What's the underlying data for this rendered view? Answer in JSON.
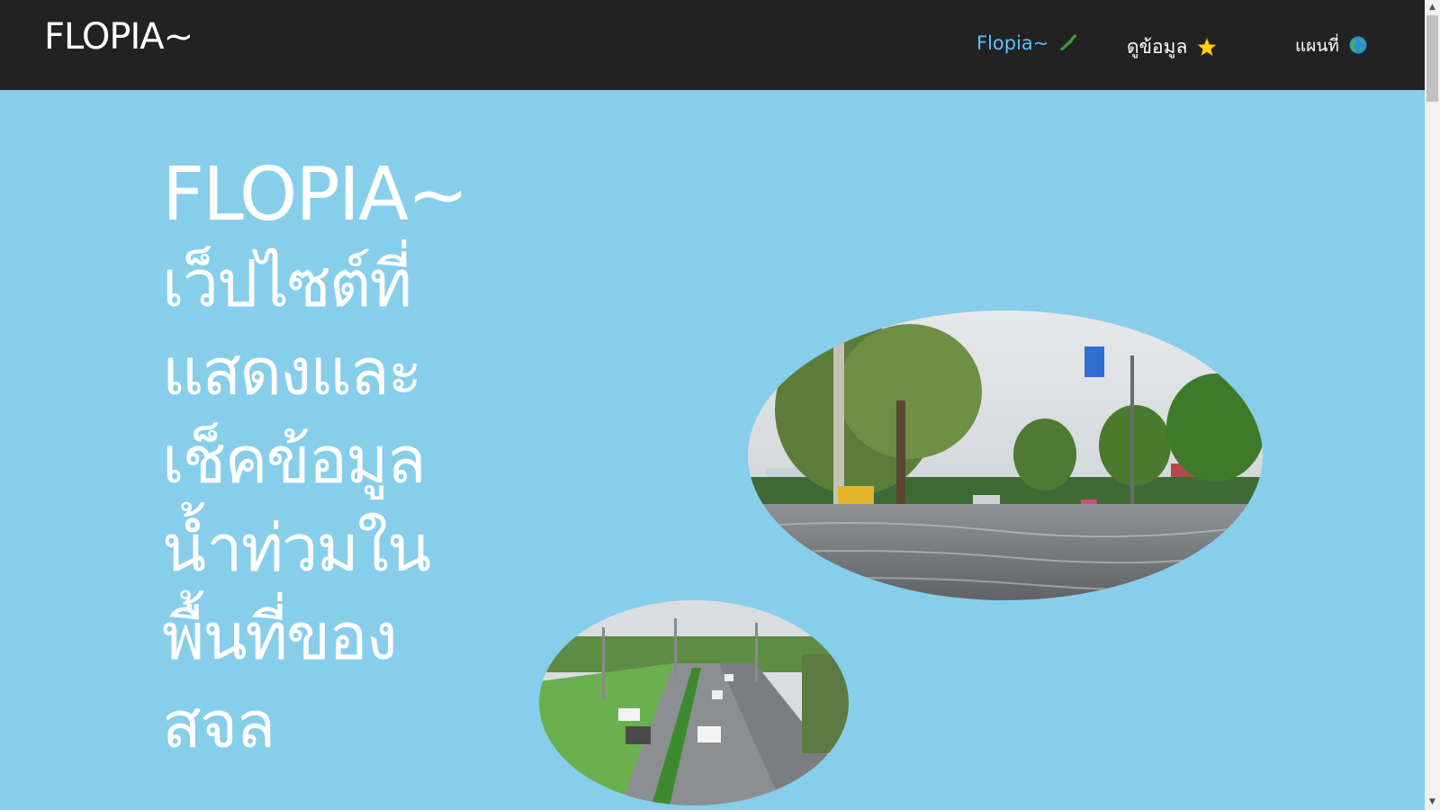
{
  "navbar": {
    "brand": "FLOPIA~",
    "items": [
      {
        "label": "Flopia~",
        "icon": "japan-map-icon",
        "active": true
      },
      {
        "label": "ดูข้อมูล",
        "icon": "star-icon",
        "active": false
      },
      {
        "label": "แผนที่",
        "icon": "globe-icon",
        "active": false
      }
    ]
  },
  "hero": {
    "title": "FLOPIA~",
    "subtitle": "เว็ปไซต์ที่แสดงและเช็คข้อมูลน้ำท่วมในพื้นที่ของ สจล"
  },
  "images": [
    {
      "name": "flooded-street-photo",
      "description_icon": "photo"
    },
    {
      "name": "flooded-road-aerial-photo",
      "description_icon": "photo"
    }
  ],
  "colors": {
    "navbar_bg": "#222222",
    "page_bg": "#87ceeb",
    "active_link": "#5bc0f8",
    "text": "#ffffff"
  }
}
